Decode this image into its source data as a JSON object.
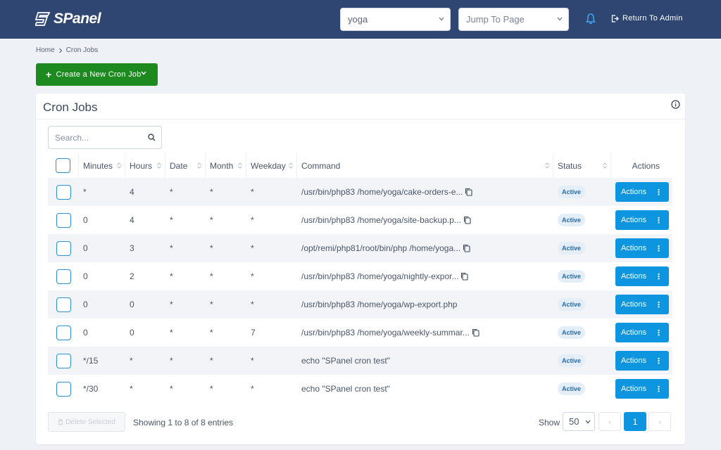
{
  "brand": {
    "name": "SPanel"
  },
  "header": {
    "user_select": "yoga",
    "jump_placeholder": "Jump To Page",
    "return_label": "Return To Admin"
  },
  "breadcrumb": {
    "home": "Home",
    "current": "Cron Jobs"
  },
  "create_button": {
    "label": "Create a New Cron Job"
  },
  "card": {
    "title": "Cron Jobs"
  },
  "search": {
    "placeholder": "Search..."
  },
  "table": {
    "columns": [
      "Minutes",
      "Hours",
      "Date",
      "Month",
      "Weekday",
      "Command",
      "Status",
      "Actions"
    ],
    "rows": [
      {
        "minutes": "*",
        "hours": "4",
        "date": "*",
        "month": "*",
        "weekday": "*",
        "command": "/usr/bin/php83 /home/yoga/cake-orders-e...",
        "copy": true,
        "status": "Active",
        "action": "Actions"
      },
      {
        "minutes": "0",
        "hours": "4",
        "date": "*",
        "month": "*",
        "weekday": "*",
        "command": "/usr/bin/php83 /home/yoga/site-backup.p...",
        "copy": true,
        "status": "Active",
        "action": "Actions"
      },
      {
        "minutes": "0",
        "hours": "3",
        "date": "*",
        "month": "*",
        "weekday": "*",
        "command": "/opt/remi/php81/root/bin/php /home/yoga...",
        "copy": true,
        "status": "Active",
        "action": "Actions"
      },
      {
        "minutes": "0",
        "hours": "2",
        "date": "*",
        "month": "*",
        "weekday": "*",
        "command": "/usr/bin/php83 /home/yoga/nightly-expor...",
        "copy": true,
        "status": "Active",
        "action": "Actions"
      },
      {
        "minutes": "0",
        "hours": "0",
        "date": "*",
        "month": "*",
        "weekday": "*",
        "command": "/usr/bin/php83 /home/yoga/wp-export.php",
        "copy": false,
        "status": "Active",
        "action": "Actions"
      },
      {
        "minutes": "0",
        "hours": "0",
        "date": "*",
        "month": "*",
        "weekday": "7",
        "command": "/usr/bin/php83 /home/yoga/weekly-summar...",
        "copy": true,
        "status": "Active",
        "action": "Actions"
      },
      {
        "minutes": "*/15",
        "hours": "*",
        "date": "*",
        "month": "*",
        "weekday": "*",
        "command": "echo \"SPanel cron test\"",
        "copy": false,
        "status": "Active",
        "action": "Actions"
      },
      {
        "minutes": "*/30",
        "hours": "*",
        "date": "*",
        "month": "*",
        "weekday": "*",
        "command": "echo \"SPanel cron test\"",
        "copy": false,
        "status": "Active",
        "action": "Actions"
      }
    ]
  },
  "footer": {
    "delete_label": "Delete Selected",
    "showing": "Showing 1 to 8 of 8 entries",
    "show_label": "Show",
    "page_size": "50",
    "current_page": "1",
    "prev": "‹",
    "next": "›"
  },
  "colors": {
    "topbar": "#2f4672",
    "create_green": "#1d8a20",
    "accent_blue": "#0d95e0"
  }
}
